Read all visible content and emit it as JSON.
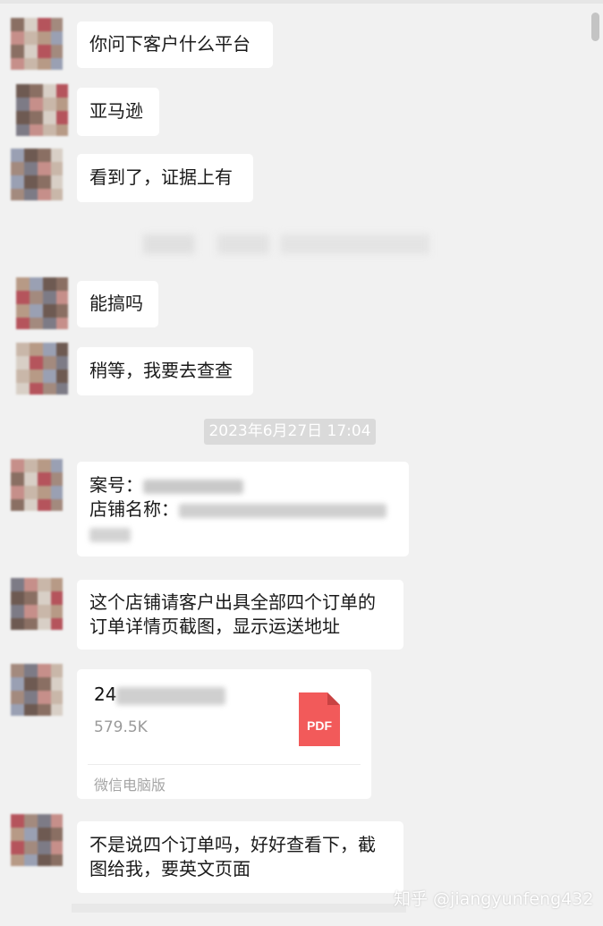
{
  "messages": [
    {
      "text": "你问下客户什么平台"
    },
    {
      "text": "亚马逊"
    },
    {
      "text": "看到了，证据上有"
    },
    {
      "text": "能搞吗"
    },
    {
      "text": "稍等，我要去查查"
    },
    {
      "line1": "案号：",
      "line2": "店铺名称："
    },
    {
      "line1": "这个店铺请客户出具全部四个订单的",
      "line2": "订单详情页截图，显示运送地址"
    },
    {
      "line1": "不是说四个订单吗，好好查看下，截",
      "line2": "图给我，要英文页面"
    }
  ],
  "timestamp": "2023年6月27日 17:04",
  "file": {
    "name": "24",
    "size": "579.5K",
    "type_label": "PDF",
    "source": "微信电脑版",
    "icon_color": "#f25a5a"
  },
  "watermark": "知乎 @jiangyunfeng432",
  "colors": {
    "background": "#f1f1f1",
    "bubble": "#ffffff",
    "timestamp_bg": "#dadada"
  }
}
